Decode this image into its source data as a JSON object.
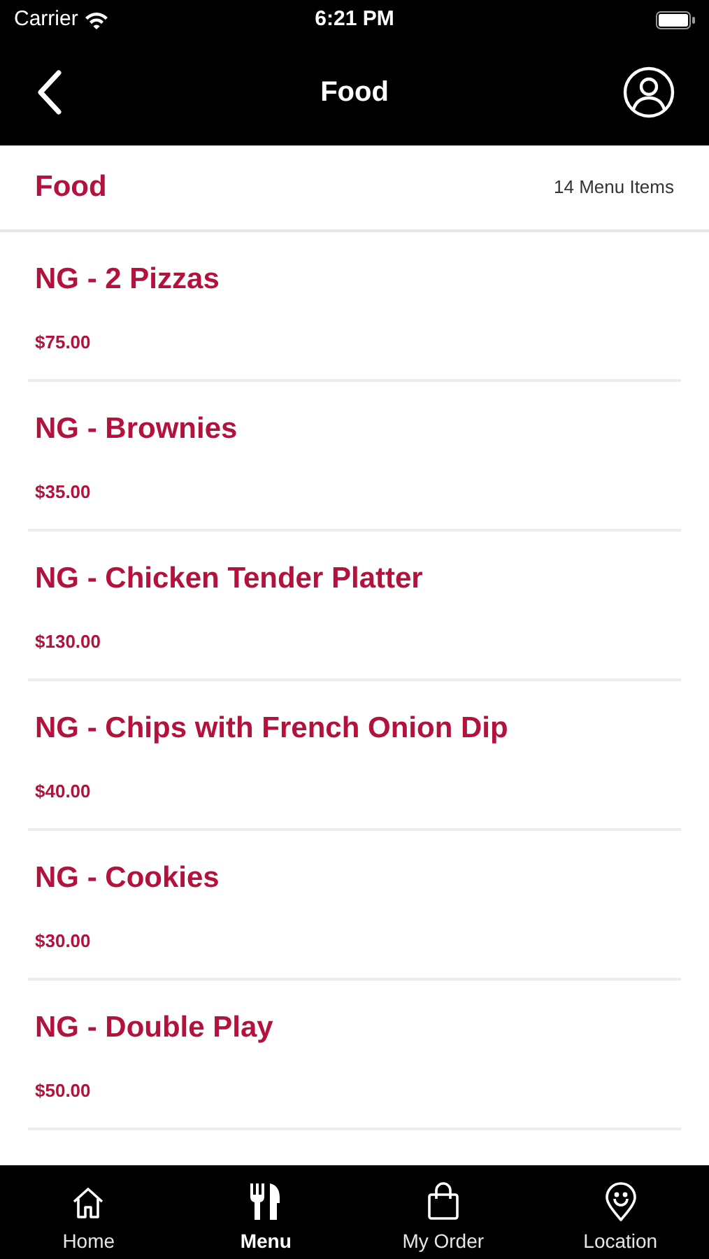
{
  "status_bar": {
    "carrier": "Carrier",
    "time": "6:21 PM"
  },
  "nav_bar": {
    "title": "Food"
  },
  "category": {
    "title": "Food",
    "count": "14 Menu Items"
  },
  "items": [
    {
      "name": "NG - 2 Pizzas",
      "price": "$75.00"
    },
    {
      "name": "NG - Brownies",
      "price": "$35.00"
    },
    {
      "name": "NG - Chicken Tender Platter",
      "price": "$130.00"
    },
    {
      "name": "NG - Chips with French Onion Dip",
      "price": "$40.00"
    },
    {
      "name": "NG - Cookies",
      "price": "$30.00"
    },
    {
      "name": "NG - Double Play",
      "price": "$50.00"
    }
  ],
  "tab_bar": [
    {
      "kind": "home",
      "label": "Home",
      "selected": false
    },
    {
      "kind": "menu",
      "label": "Menu",
      "selected": true
    },
    {
      "kind": "order",
      "label": "My Order",
      "selected": false
    },
    {
      "kind": "location",
      "label": "Location",
      "selected": false
    }
  ]
}
